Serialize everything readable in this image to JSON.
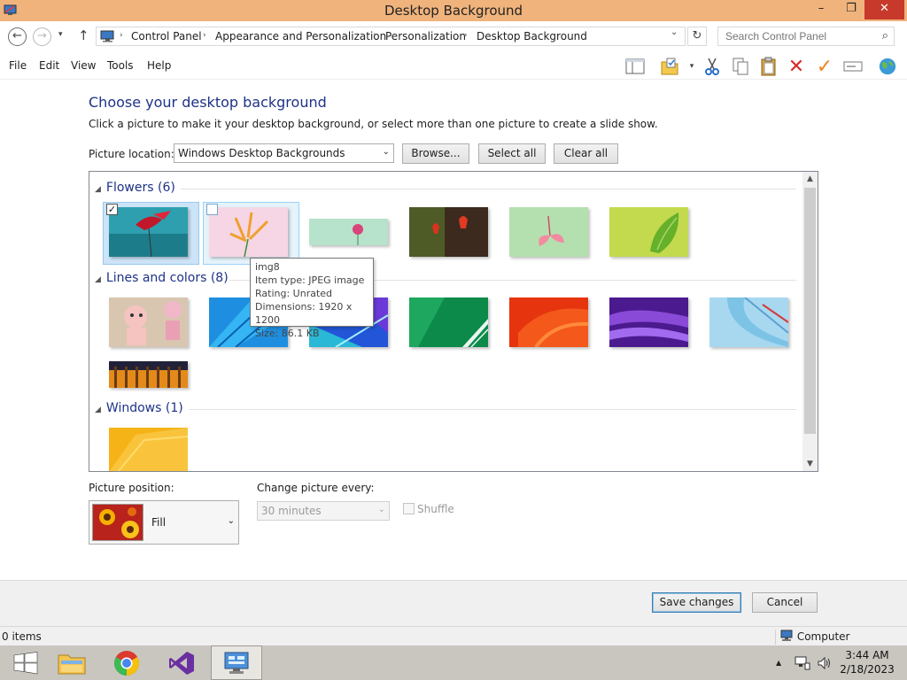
{
  "window": {
    "title": "Desktop Background",
    "min_glyph": "–",
    "max_glyph": "❐",
    "close_glyph": "✕"
  },
  "address": {
    "back_glyph": "←",
    "forward_glyph": "→",
    "dropdown_glyph": "▾",
    "up_glyph": "↑",
    "breadcrumbs": [
      "Control Panel",
      "Appearance and Personalization",
      "Personalization",
      "Desktop Background"
    ],
    "crumb_sep": "›",
    "addr_dropdown_glyph": "⌄",
    "refresh_glyph": "↻",
    "search_placeholder": "Search Control Panel",
    "search_glyph": "⌕"
  },
  "menu": {
    "items": [
      "File",
      "Edit",
      "View",
      "Tools",
      "Help"
    ]
  },
  "toolbar": {
    "icons": [
      "layout-pane-icon",
      "properties-icon",
      "dropdown-icon",
      "cut-icon",
      "copy-icon",
      "paste-icon",
      "delete-icon",
      "checkmark-icon",
      "rename-icon",
      "globe-icon"
    ]
  },
  "page": {
    "heading": "Choose your desktop background",
    "subheading": "Click a picture to make it your desktop background, or select more than one picture to create a slide show.",
    "location_label": "Picture location:",
    "location_value": "Windows Desktop Backgrounds",
    "browse_label": "Browse...",
    "select_all_label": "Select all",
    "clear_all_label": "Clear all",
    "select_arrow": "⌄"
  },
  "gallery": {
    "groups": [
      {
        "name": "Flowers (6)"
      },
      {
        "name": "Lines and colors (8)"
      },
      {
        "name": "Windows (1)"
      }
    ],
    "collapse_glyph": "◢",
    "check_glyph": "✓",
    "scroll_up_glyph": "▲",
    "scroll_down_glyph": "▼"
  },
  "tooltip": {
    "lines": [
      "img8",
      "Item type: JPEG image",
      "Rating: Unrated",
      "Dimensions: 1920 x 1200",
      "Size: 86.1 KB"
    ]
  },
  "options": {
    "position_label": "Picture position:",
    "position_value": "Fill",
    "change_label": "Change picture every:",
    "change_value": "30 minutes",
    "shuffle_label": "Shuffle"
  },
  "footer": {
    "save_label": "Save changes",
    "cancel_label": "Cancel"
  },
  "status": {
    "items_text": "0 items",
    "computer_text": "Computer"
  },
  "taskbar": {
    "apps": [
      "start-button",
      "file-explorer",
      "chrome",
      "visual-studio",
      "control-panel"
    ],
    "time": "3:44 AM",
    "date": "2/18/2023",
    "tray_up_glyph": "▲"
  },
  "colors": {
    "titlebar": "#f0b37c",
    "heading": "#1e3287",
    "selection": "#cce4f7",
    "close_button": "#c7392a"
  }
}
